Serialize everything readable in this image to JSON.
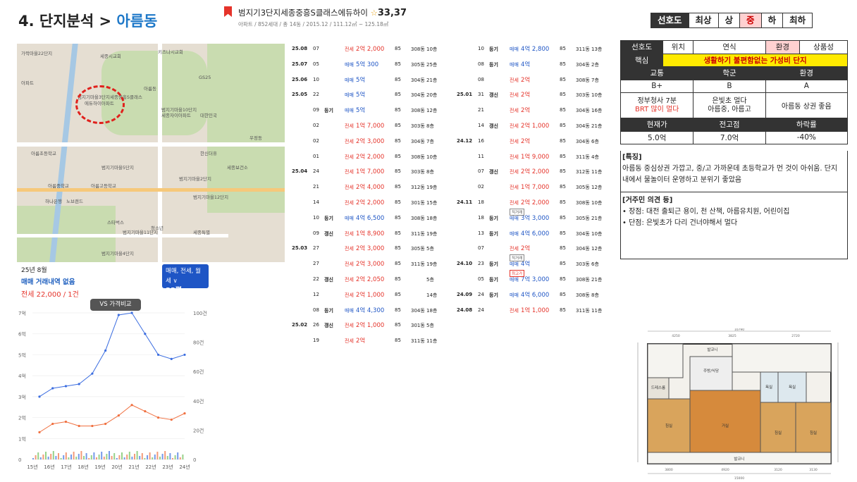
{
  "title": {
    "prefix": "4. 단지분석 > ",
    "location": "아름동"
  },
  "apartment": {
    "name": "범지기3단지세종중흥S클래스에듀하이",
    "star": "☆",
    "score": "33,37",
    "sub": "아파트 / 852세대 / 총 14동 / 2015.12 / 111.12㎡ ~ 125.18㎡"
  },
  "preference": {
    "label": "선호도",
    "options": [
      "최상",
      "상",
      "중",
      "하",
      "최하"
    ],
    "active": "중"
  },
  "map": {
    "labels": [
      "가락마을22단지",
      "세종시교회",
      "키즈나시교회",
      "아파트",
      "범지기마을3단지세종중흥S클래스",
      "에듀하이아파트",
      "아름동",
      "GS25",
      "범지기마을10단지",
      "세종자이아파트",
      "대한민국",
      "우정동",
      "범지기마을5단지",
      "한신더휴",
      "아름고등학교",
      "범지기마을2단지",
      "세종보건소",
      "아름초등학교",
      "노브랜드",
      "스타벅스",
      "범지기마을12단지",
      "하나은행",
      "범지기마을11단지",
      "아름중학교",
      "청소년",
      "세종특별",
      "범지기마을4단지"
    ]
  },
  "trade": {
    "month": "25년 8월",
    "none": "매매 거래내역 없음",
    "last": "전세 22,000 / 1건",
    "filter_line1": "매매, 전세, 월세 ∨",
    "filter_py": "33평",
    "filter_area": "전용 85㎡",
    "vs": "VS 가격비교"
  },
  "chart_data": {
    "type": "line",
    "x_ticks": [
      "15년",
      "16년",
      "17년",
      "18년",
      "19년",
      "20년",
      "21년",
      "22년",
      "23년",
      "24년"
    ],
    "y_ticks": [
      "0",
      "1억",
      "2억",
      "3억",
      "4억",
      "5억",
      "6억",
      "7억"
    ],
    "y2_ticks": [
      "0",
      "20건",
      "40건",
      "60건",
      "80건",
      "100건"
    ],
    "ylim": [
      0,
      7
    ],
    "series": [
      {
        "type": "매매",
        "color": "#3b6de0",
        "values": [
          3.0,
          3.4,
          3.5,
          3.6,
          4.1,
          5.2,
          6.9,
          7.0,
          6.0,
          5.0,
          4.8,
          5.0
        ]
      },
      {
        "type": "전세",
        "color": "#f07040",
        "values": [
          1.3,
          1.7,
          1.8,
          1.6,
          1.6,
          1.7,
          2.1,
          2.6,
          2.3,
          2.0,
          1.9,
          2.2
        ]
      }
    ]
  },
  "transactions": {
    "col1": [
      {
        "ym": "25.08",
        "d": "07",
        "tag": "",
        "type": "전세",
        "price": "2억 2,000",
        "area": "85",
        "dong": "308동",
        "fl": "10층"
      },
      {
        "ym": "25.07",
        "d": "05",
        "tag": "",
        "type": "매매",
        "price": "5억 300",
        "area": "85",
        "dong": "305동",
        "fl": "25층"
      },
      {
        "ym": "25.06",
        "d": "10",
        "tag": "",
        "type": "매매",
        "price": "5억",
        "area": "85",
        "dong": "304동",
        "fl": "21층"
      },
      {
        "ym": "25.05",
        "d": "22",
        "tag": "",
        "type": "매매",
        "price": "5억",
        "area": "85",
        "dong": "304동",
        "fl": "20층"
      },
      {
        "ym": "",
        "d": "09",
        "tag": "등기",
        "type": "매매",
        "price": "5억",
        "area": "85",
        "dong": "308동",
        "fl": "12층"
      },
      {
        "ym": "",
        "d": "02",
        "tag": "",
        "type": "전세",
        "price": "1억 7,000",
        "area": "85",
        "dong": "303동",
        "fl": "8층"
      },
      {
        "ym": "",
        "d": "02",
        "tag": "",
        "type": "전세",
        "price": "2억 3,000",
        "area": "85",
        "dong": "304동",
        "fl": "7층"
      },
      {
        "ym": "",
        "d": "01",
        "tag": "",
        "type": "전세",
        "price": "2억 2,000",
        "area": "85",
        "dong": "308동",
        "fl": "10층"
      },
      {
        "ym": "25.04",
        "d": "24",
        "tag": "",
        "type": "전세",
        "price": "1억 7,000",
        "area": "85",
        "dong": "303동",
        "fl": "8층"
      },
      {
        "ym": "",
        "d": "21",
        "tag": "",
        "type": "전세",
        "price": "2억 4,000",
        "area": "85",
        "dong": "312동",
        "fl": "19층"
      },
      {
        "ym": "",
        "d": "14",
        "tag": "",
        "type": "전세",
        "price": "2억 2,000",
        "area": "85",
        "dong": "301동",
        "fl": "15층"
      },
      {
        "ym": "",
        "d": "10",
        "tag": "등기",
        "type": "매매",
        "price": "4억 6,500",
        "area": "85",
        "dong": "308동",
        "fl": "18층"
      },
      {
        "ym": "",
        "d": "09",
        "tag": "갱신",
        "type": "전세",
        "price": "1억 8,900",
        "area": "85",
        "dong": "311동",
        "fl": "19층"
      },
      {
        "ym": "25.03",
        "d": "27",
        "tag": "",
        "type": "전세",
        "price": "2억 3,000",
        "area": "85",
        "dong": "305동",
        "fl": "5층"
      },
      {
        "ym": "",
        "d": "27",
        "tag": "",
        "type": "전세",
        "price": "2억 3,000",
        "area": "85",
        "dong": "311동",
        "fl": "19층"
      },
      {
        "ym": "",
        "d": "22",
        "tag": "갱신",
        "type": "전세",
        "price": "2억 2,050",
        "area": "85",
        "dong": "",
        "fl": "5층"
      },
      {
        "ym": "",
        "d": "12",
        "tag": "",
        "type": "전세",
        "price": "2억 1,000",
        "area": "85",
        "dong": "",
        "fl": "14층"
      },
      {
        "ym": "",
        "d": "08",
        "tag": "등기",
        "type": "매매",
        "price": "4억 4,300",
        "area": "85",
        "dong": "304동",
        "fl": "18층"
      },
      {
        "ym": "25.02",
        "d": "26",
        "tag": "갱신",
        "type": "전세",
        "price": "2억 1,000",
        "area": "85",
        "dong": "301동",
        "fl": "5층"
      },
      {
        "ym": "",
        "d": "19",
        "tag": "",
        "type": "전세",
        "price": "2억",
        "area": "85",
        "dong": "311동",
        "fl": "11층"
      }
    ],
    "col2": [
      {
        "ym": "",
        "d": "10",
        "tag": "등기",
        "type": "매매",
        "price": "4억 2,800",
        "area": "85",
        "dong": "311동",
        "fl": "13층",
        "badge": ""
      },
      {
        "ym": "",
        "d": "08",
        "tag": "등기",
        "type": "매매",
        "price": "4억",
        "area": "85",
        "dong": "304동",
        "fl": "2층",
        "badge": ""
      },
      {
        "ym": "",
        "d": "08",
        "tag": "",
        "type": "전세",
        "price": "2억",
        "area": "85",
        "dong": "308동",
        "fl": "7층",
        "badge": ""
      },
      {
        "ym": "25.01",
        "d": "31",
        "tag": "갱신",
        "type": "전세",
        "price": "2억",
        "area": "85",
        "dong": "303동",
        "fl": "10층",
        "badge": ""
      },
      {
        "ym": "",
        "d": "21",
        "tag": "",
        "type": "전세",
        "price": "2억",
        "area": "85",
        "dong": "304동",
        "fl": "16층",
        "badge": ""
      },
      {
        "ym": "",
        "d": "14",
        "tag": "갱신",
        "type": "전세",
        "price": "2억 1,000",
        "area": "85",
        "dong": "304동",
        "fl": "21층",
        "badge": ""
      },
      {
        "ym": "24.12",
        "d": "16",
        "tag": "",
        "type": "전세",
        "price": "2억",
        "area": "85",
        "dong": "304동",
        "fl": "6층",
        "badge": ""
      },
      {
        "ym": "",
        "d": "11",
        "tag": "",
        "type": "전세",
        "price": "1억 9,000",
        "area": "85",
        "dong": "311동",
        "fl": "4층",
        "badge": ""
      },
      {
        "ym": "",
        "d": "07",
        "tag": "갱신",
        "type": "전세",
        "price": "2억 2,000",
        "area": "85",
        "dong": "312동",
        "fl": "11층",
        "badge": ""
      },
      {
        "ym": "",
        "d": "02",
        "tag": "",
        "type": "전세",
        "price": "1억 7,000",
        "area": "85",
        "dong": "305동",
        "fl": "12층",
        "badge": ""
      },
      {
        "ym": "24.11",
        "d": "18",
        "tag": "",
        "type": "전세",
        "price": "2억 2,000",
        "area": "85",
        "dong": "308동",
        "fl": "10층",
        "badge": ""
      },
      {
        "ym": "",
        "d": "18",
        "tag": "등기",
        "type": "매매",
        "price": "3억 3,000",
        "area": "85",
        "dong": "305동",
        "fl": "21층",
        "badge": "직거래"
      },
      {
        "ym": "",
        "d": "13",
        "tag": "등기",
        "type": "매매",
        "price": "4억 6,000",
        "area": "85",
        "dong": "304동",
        "fl": "10층",
        "badge": ""
      },
      {
        "ym": "",
        "d": "07",
        "tag": "",
        "type": "전세",
        "price": "2억",
        "area": "85",
        "dong": "304동",
        "fl": "12층",
        "badge": ""
      },
      {
        "ym": "24.10",
        "d": "23",
        "tag": "등기",
        "type": "매매",
        "price": "4억",
        "area": "85",
        "dong": "303동",
        "fl": "6층",
        "badge": "직거래"
      },
      {
        "ym": "",
        "d": "05",
        "tag": "등기",
        "type": "매매",
        "price": "7억 3,000",
        "area": "85",
        "dong": "308동",
        "fl": "21층",
        "badge": "최고가"
      },
      {
        "ym": "24.09",
        "d": "24",
        "tag": "등기",
        "type": "매매",
        "price": "4억 6,000",
        "area": "85",
        "dong": "308동",
        "fl": "8층",
        "badge": ""
      },
      {
        "ym": "24.08",
        "d": "24",
        "tag": "",
        "type": "전세",
        "price": "1억 1,000",
        "area": "85",
        "dong": "311동",
        "fl": "11층",
        "badge": ""
      }
    ]
  },
  "info": {
    "header": [
      "선호도",
      "위치",
      "연식",
      "환경",
      "상품성"
    ],
    "core_label": "핵심",
    "core_text": "생활하기 불편함없는 가성비 단지",
    "sub_header": [
      "교통",
      "학군",
      "환경"
    ],
    "grades": [
      "B+",
      "B",
      "A"
    ],
    "details": [
      {
        "line1": "정부청사 7분",
        "line2": "BRT 많이 멀다"
      },
      {
        "line1": "은빛초 멀다",
        "line2": "아름중, 아름고"
      },
      {
        "line1": "아름동 상권 좋음",
        "line2": ""
      }
    ],
    "price_header": [
      "현재가",
      "전고점",
      "하락률"
    ],
    "prices": [
      "5.0억",
      "7.0억",
      "-40%"
    ]
  },
  "features": {
    "title": "[특징]",
    "text": "아름동 중심상권 가깝고, 중/고 가까운데 초등학교가 먼 것이 아쉬움. 단지 내에서 물놀이터 운영하고 분위기 좋았음",
    "opinion_title": "[거주민 의견 등]",
    "pro": "• 장점: 대전 출퇴근 용이, 천 산책, 아름유치원, 어린이집",
    "con": "• 단점: 은빛초가 다리 건너야해서 멀다"
  },
  "floorplan": {
    "rooms": [
      "발코니",
      "주방/식당",
      "드레스룸",
      "침실",
      "거실",
      "침실",
      "침실",
      "발코니",
      "욕실",
      "욕실"
    ],
    "dims": [
      "10790",
      "4250",
      "3825",
      "2720",
      "3800",
      "4920",
      "3120",
      "3130",
      "15000"
    ]
  }
}
